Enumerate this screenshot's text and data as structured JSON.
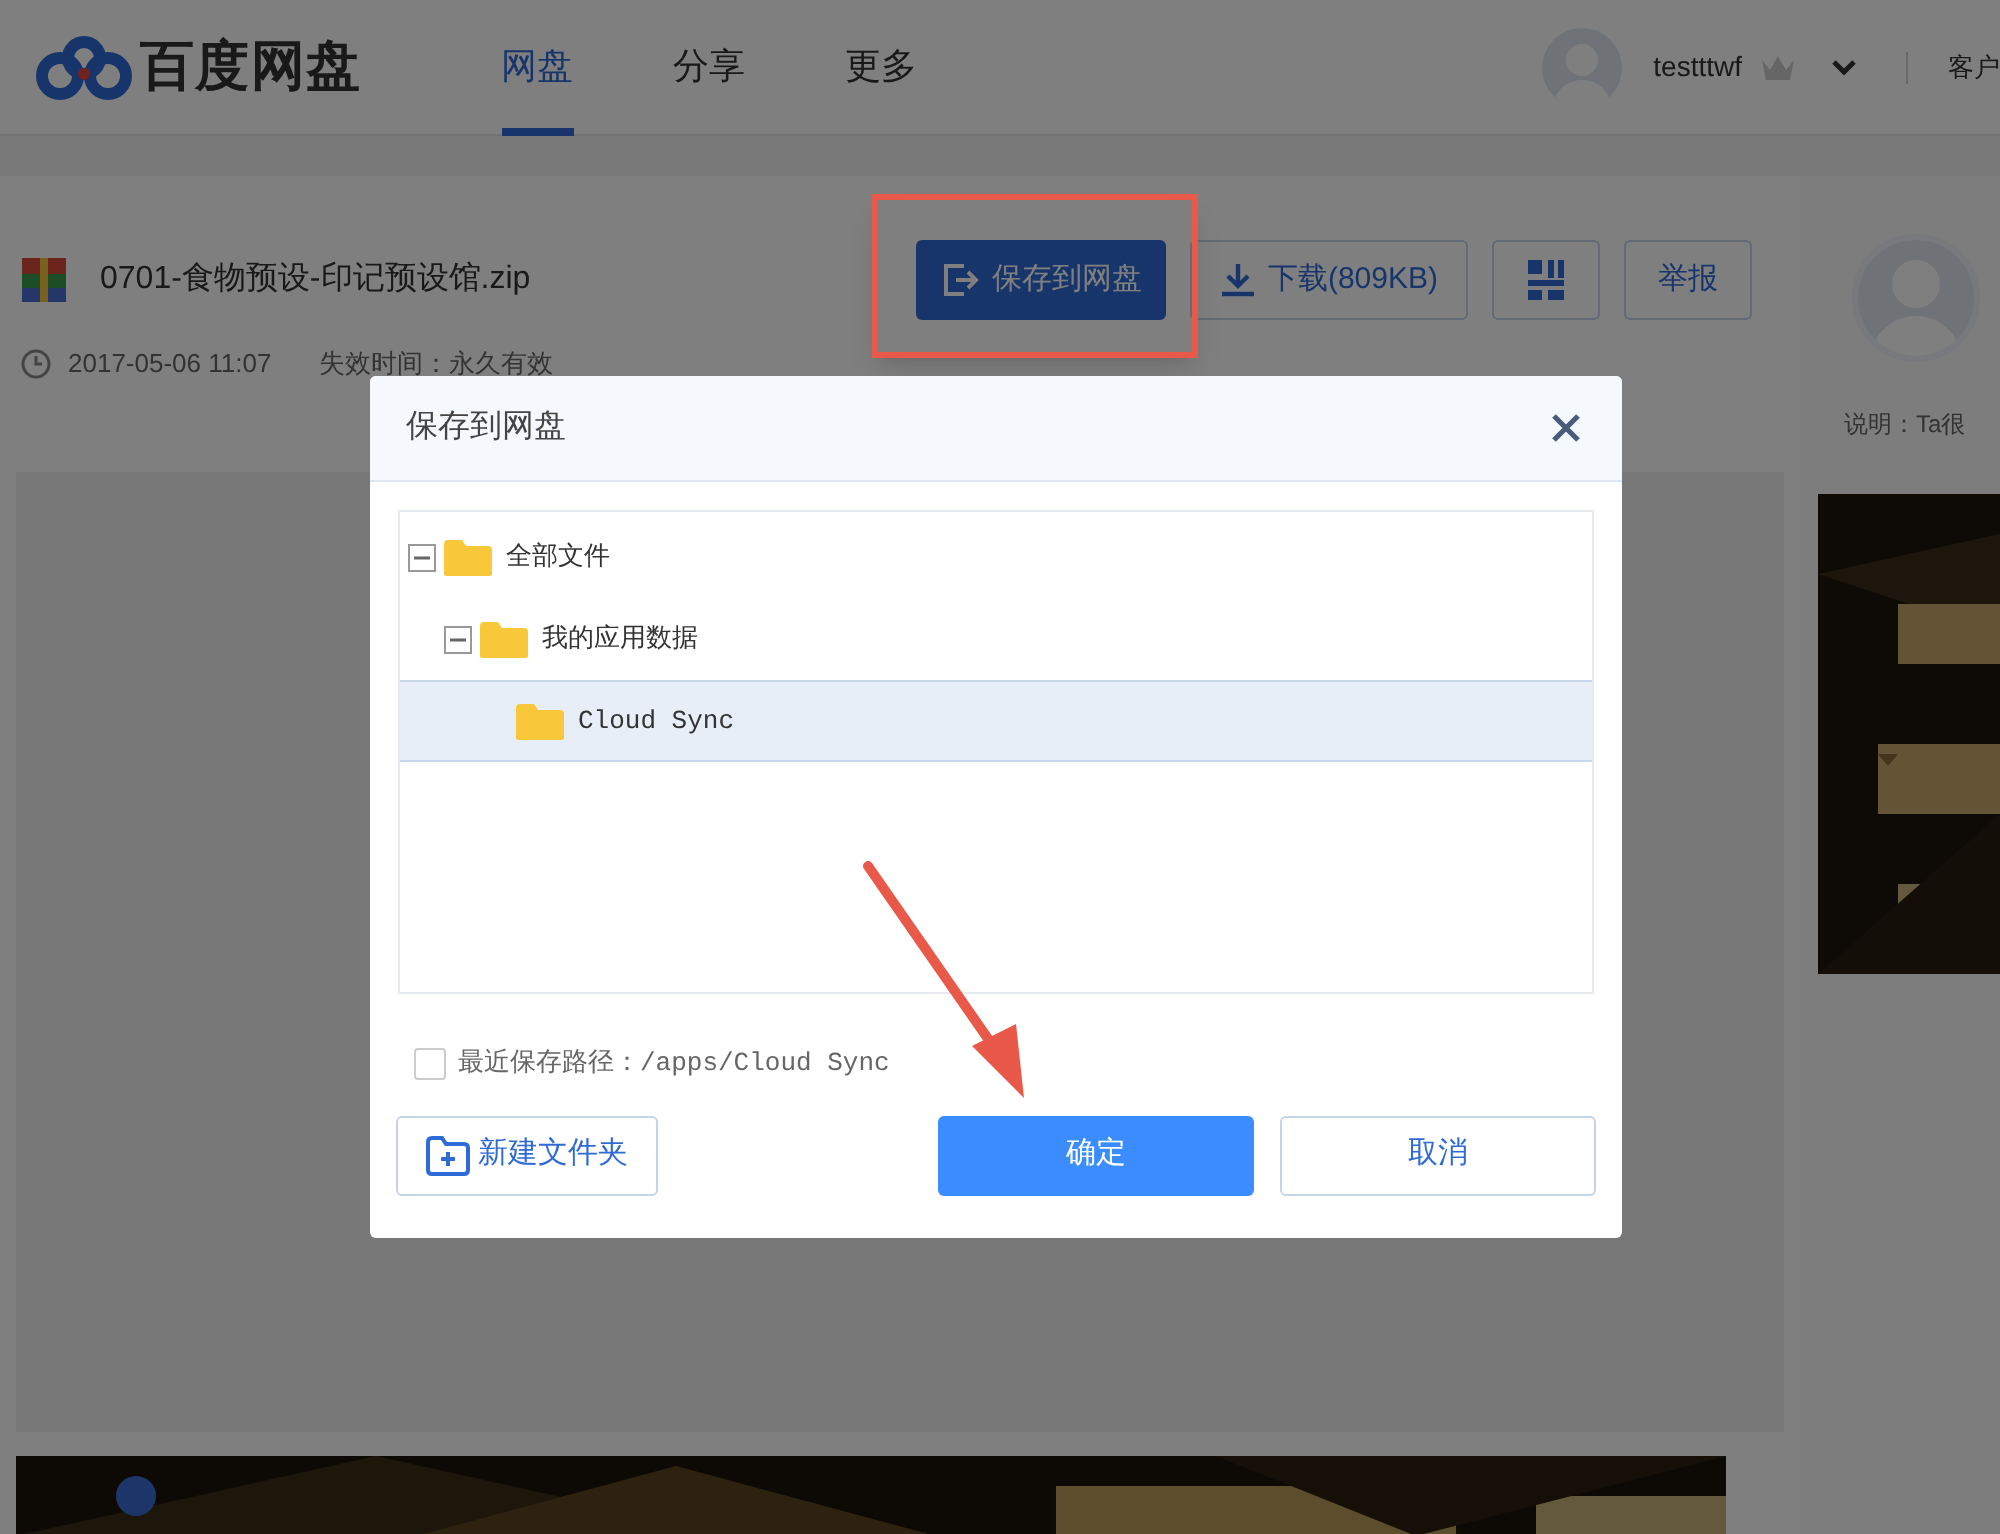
{
  "header": {
    "logo_text": "百度网盘",
    "nav": [
      {
        "label": "网盘",
        "selected": true
      },
      {
        "label": "分享",
        "selected": false
      },
      {
        "label": "更多",
        "selected": false
      }
    ],
    "username": "testttwf",
    "client_link": "客户"
  },
  "file": {
    "name": "0701-食物预设-印记预设馆.zip",
    "date": "2017-05-06 11:07",
    "expiry": "失效时间：永久有效",
    "actions": [
      {
        "kind": "primary",
        "label": "保存到网盘"
      },
      {
        "kind": "download",
        "label": "下载(809KB)"
      },
      {
        "kind": "qr"
      },
      {
        "kind": "text",
        "label": "举报"
      }
    ]
  },
  "sidebar": {
    "description": "说明：Ta很"
  },
  "dialog": {
    "title": "保存到网盘",
    "tree": [
      {
        "label": "全部文件",
        "expanded": true,
        "selected": false,
        "children": [
          {
            "label": "我的应用数据",
            "expanded": true,
            "selected": false,
            "children": [
              {
                "label": "Cloud Sync",
                "selected": true
              }
            ]
          }
        ]
      }
    ],
    "recent_path": {
      "checked": false,
      "label": "最近保存路径：/apps/Cloud Sync"
    },
    "buttons": [
      {
        "kind": "new_folder",
        "label": "新建文件夹"
      },
      {
        "kind": "confirm",
        "label": "确定"
      },
      {
        "kind": "cancel",
        "label": "取消"
      }
    ]
  }
}
